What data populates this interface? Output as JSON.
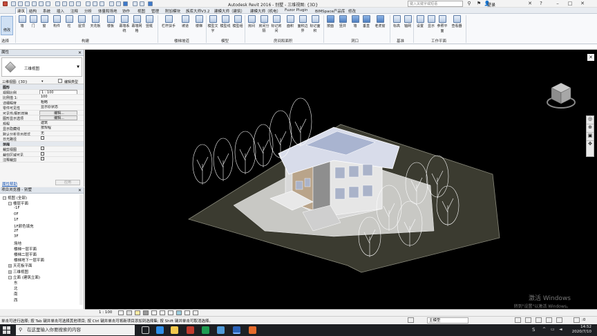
{
  "window": {
    "title": "Autodesk Revit 2016 -   别墅 - 三维视图: {3D}",
    "search_placeholder": "键入关键字或短语",
    "user": "登录"
  },
  "ribbon_tabs": [
    "建筑",
    "结构",
    "系统",
    "插入",
    "注释",
    "分析",
    "体量和场地",
    "协作",
    "视图",
    "管理",
    "附加模块",
    "族库大师V3.2",
    "建模大师（建筑）",
    "建模大师（机电）",
    "Fuzor Plugin",
    "BIMSpace产品库",
    "修改"
  ],
  "ribbon": {
    "modify": "修改",
    "select_label": "选择",
    "groups": [
      {
        "label": "构建",
        "buttons": [
          "墙",
          "门",
          "窗",
          "构件",
          "柱",
          "屋顶",
          "天花板",
          "楼板",
          "幕墙系统",
          "幕墙网格",
          "竖梃"
        ]
      },
      {
        "label": "楼梯坡道",
        "buttons": [
          "栏杆扶手",
          "坡道",
          "楼梯"
        ]
      },
      {
        "label": "模型",
        "buttons": [
          "模型文字",
          "模型线",
          "模型组"
        ]
      },
      {
        "label": "房间和面积",
        "buttons": [
          "房间",
          "房间分隔",
          "标记房间",
          "面积",
          "面积边界",
          "标记面积"
        ]
      },
      {
        "label": "洞口",
        "buttons": [
          "按面",
          "竖井",
          "墙",
          "垂直",
          "老虎窗"
        ]
      },
      {
        "label": "基准",
        "buttons": [
          "标高",
          "轴网"
        ]
      },
      {
        "label": "工作平面",
        "buttons": [
          "设置",
          "显示",
          "参照平面",
          "查看器"
        ]
      }
    ]
  },
  "properties": {
    "title": "属性",
    "type_name": "三维视图",
    "instance_selector": "三维视图: {3D}",
    "edit_type": "编辑类型",
    "rows": [
      {
        "k": "图形",
        "v": "",
        "group": true
      },
      {
        "k": "视图比例",
        "v": "1 : 100",
        "edit": true
      },
      {
        "k": "比例值 1:",
        "v": "100"
      },
      {
        "k": "详细程度",
        "v": "粗略"
      },
      {
        "k": "零件可见性",
        "v": "显示原状态"
      },
      {
        "k": "可见性/图形替换",
        "v": "编辑...",
        "btn": true
      },
      {
        "k": "图形显示选项",
        "v": "编辑...",
        "btn": true
      },
      {
        "k": "规程",
        "v": "建筑"
      },
      {
        "k": "显示隐藏线",
        "v": "按规程"
      },
      {
        "k": "默认分析显示样式",
        "v": "无"
      },
      {
        "k": "日光路径",
        "v": "",
        "cb": true
      },
      {
        "k": "范围",
        "v": "",
        "group": true
      },
      {
        "k": "裁剪视图",
        "v": "",
        "cb": true
      },
      {
        "k": "裁剪区域可见",
        "v": "",
        "cb": true
      },
      {
        "k": "注释裁剪",
        "v": "",
        "cb": true
      }
    ],
    "help": "属性帮助",
    "apply": "应用"
  },
  "browser": {
    "title": "项目浏览器 - 别墅",
    "tree": [
      {
        "label": "视图 (全部)",
        "level": 0,
        "toggle": "-"
      },
      {
        "label": "楼层平面",
        "level": 1,
        "toggle": "-"
      },
      {
        "label": "-1F",
        "level": 2
      },
      {
        "label": "0F",
        "level": 2
      },
      {
        "label": "1F",
        "level": 2
      },
      {
        "label": "1F颜色填充",
        "level": 2
      },
      {
        "label": "2F",
        "level": 2
      },
      {
        "label": "3F",
        "level": 2
      },
      {
        "label": "场地",
        "level": 2
      },
      {
        "label": "楼梯一层平面",
        "level": 2
      },
      {
        "label": "楼梯二层平面",
        "level": 2
      },
      {
        "label": "楼梯地下一层平面",
        "level": 2
      },
      {
        "label": "天花板平面",
        "level": 1,
        "toggle": "+"
      },
      {
        "label": "三维视图",
        "level": 1,
        "toggle": "+"
      },
      {
        "label": "立面 (建筑立面)",
        "level": 1,
        "toggle": "-"
      },
      {
        "label": "东",
        "level": 2
      },
      {
        "label": "北",
        "level": 2
      },
      {
        "label": "南",
        "level": 2
      },
      {
        "label": "西",
        "level": 2
      }
    ]
  },
  "canvas": {
    "activate_title": "激活 Windows",
    "activate_sub": "转到\"设置\"以激活 Windows。"
  },
  "viewbar": {
    "scale": "1 : 100"
  },
  "status": {
    "hint": "单击可进行选择; 按 Tab 键并单击可选择其他项目; 按 Ctrl 键并单击可将新项目添加到选择集; 按 Shift 键并单击可取消选择。",
    "workset": "主模型",
    "filter_count": ":0"
  },
  "taskbar": {
    "search_placeholder": "在这里输入你要搜索的内容",
    "time": "14:52",
    "date": "2020/7/10"
  }
}
